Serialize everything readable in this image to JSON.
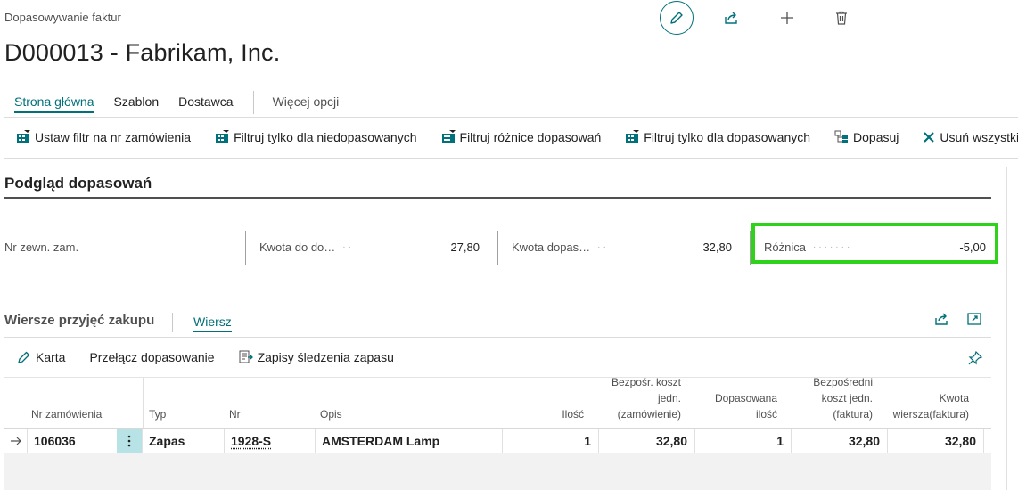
{
  "header": {
    "breadcrumb": "Dopasowywanie faktur",
    "title": "D000013 - Fabrikam, Inc.",
    "top_actions": [
      "edit-icon",
      "share-icon",
      "add-icon",
      "delete-icon"
    ]
  },
  "tabs": [
    {
      "label": "Strona główna",
      "active": true
    },
    {
      "label": "Szablon",
      "active": false
    },
    {
      "label": "Dostawca",
      "active": false
    },
    {
      "label": "Więcej opcji",
      "active": false
    }
  ],
  "actions": [
    {
      "label": "Ustaw filtr na nr zamówienia",
      "icon": "filter-icon"
    },
    {
      "label": "Filtruj tylko dla niedopasowanych",
      "icon": "filter-icon"
    },
    {
      "label": "Filtruj różnice dopasowań",
      "icon": "filter-icon"
    },
    {
      "label": "Filtruj tylko dla dopasowanych",
      "icon": "filter-icon"
    },
    {
      "label": "Dopasuj",
      "icon": "match-icon"
    },
    {
      "label": "Usuń wszystkie",
      "icon": "close-icon"
    }
  ],
  "preview": {
    "title": "Podgląd dopasowań",
    "fields": [
      {
        "label": "Nr zewn. zam.",
        "value": ""
      },
      {
        "label": "Kwota do do…",
        "value": "27,80"
      },
      {
        "label": "Kwota dopas…",
        "value": "32,80"
      },
      {
        "label": "Różnica",
        "value": "-5,00"
      }
    ],
    "highlight_color": "#2fd21a"
  },
  "lines": {
    "title": "Wiersze przyjęć zakupu",
    "tab": "Wiersz",
    "actions": [
      {
        "label": "Karta",
        "icon": "edit-icon"
      },
      {
        "label": "Przełącz dopasowanie",
        "icon": ""
      },
      {
        "label": "Zapisy śledzenia zapasu",
        "icon": "tracking-icon"
      }
    ],
    "columns": {
      "nr_zam": "Nr zamówienia",
      "typ": "Typ",
      "nr": "Nr",
      "opis": "Opis",
      "ilosc": "Ilość",
      "koszt_zam": [
        "Bezpośr. koszt",
        "jedn.",
        "(zamówienie)"
      ],
      "dop_ilosc": [
        "Dopasowana",
        "ilość"
      ],
      "koszt_fakt": [
        "Bezpośredni",
        "koszt jedn.",
        "(faktura)"
      ],
      "kwota": [
        "Kwota",
        "wiersza(faktura)"
      ]
    },
    "rows": [
      {
        "nr_zam": "106036",
        "typ": "Zapas",
        "nr": "1928-S",
        "opis": "AMSTERDAM Lamp",
        "ilosc": "1",
        "koszt_zam": "32,80",
        "dop_ilosc": "1",
        "koszt_fakt": "32,80",
        "kwota": "32,80"
      }
    ]
  },
  "colors": {
    "accent": "#00707a",
    "highlight": "#2fd21a"
  }
}
